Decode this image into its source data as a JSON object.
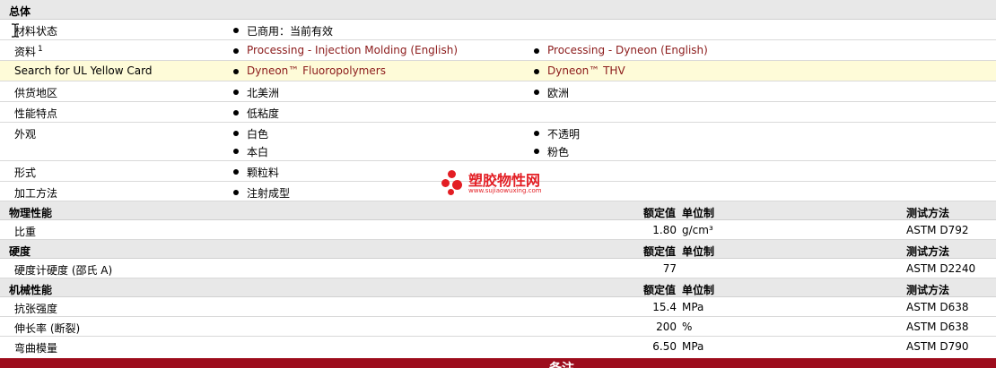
{
  "sections": {
    "general": {
      "title": "总体"
    },
    "physical": {
      "title": "物理性能",
      "col_value": "额定值",
      "col_unit": "单位制",
      "col_method": "测试方法"
    },
    "hardness": {
      "title": "硬度",
      "col_value": "额定值",
      "col_unit": "单位制",
      "col_method": "测试方法"
    },
    "mechanical": {
      "title": "机械性能",
      "col_value": "额定值",
      "col_unit": "单位制",
      "col_method": "测试方法"
    }
  },
  "general": {
    "material_status": {
      "label": "材料状态",
      "value": "已商用：当前有效"
    },
    "documents": {
      "label": "资料",
      "footnote": "1",
      "links": [
        "Processing - Injection Molding (English)",
        "Processing - Dyneon (English)"
      ]
    },
    "ul_yellow_card": {
      "label": "Search for UL Yellow Card",
      "links": [
        "Dyneon™ Fluoropolymers",
        "Dyneon™ THV"
      ]
    },
    "availability": {
      "label": "供货地区",
      "values": [
        "北美洲",
        "欧洲"
      ]
    },
    "features": {
      "label": "性能特点",
      "values": [
        "低粘度"
      ]
    },
    "appearance": {
      "label": "外观",
      "values": [
        "白色",
        "不透明",
        "本白",
        "粉色"
      ]
    },
    "forms": {
      "label": "形式",
      "values": [
        "颗粒料"
      ]
    },
    "processing": {
      "label": "加工方法",
      "values": [
        "注射成型"
      ]
    }
  },
  "physical": [
    {
      "name": "比重",
      "value": "1.80",
      "unit": "g/cm³",
      "method": "ASTM D792"
    }
  ],
  "hardness": [
    {
      "name": "硬度计硬度 (邵氏 A)",
      "value": "77",
      "unit": "",
      "method": "ASTM D2240"
    }
  ],
  "mechanical": [
    {
      "name": "抗张强度",
      "value": "15.4",
      "unit": "MPa",
      "method": "ASTM D638"
    },
    {
      "name": "伸长率 (断裂)",
      "value": "200",
      "unit": "%",
      "method": "ASTM D638"
    },
    {
      "name": "弯曲模量",
      "value": "6.50",
      "unit": "MPa",
      "method": "ASTM D790"
    }
  ],
  "watermark": {
    "name": "塑胶物性网",
    "url": "www.sujiaowuxing.com"
  },
  "footer": {
    "label": "备注"
  },
  "colors": {
    "link": "#8b1a1a",
    "highlight_row": "#fefbd8",
    "section_bg": "#e8e8e8",
    "footer_bg": "#9d0c1c",
    "watermark": "#e31e24"
  }
}
